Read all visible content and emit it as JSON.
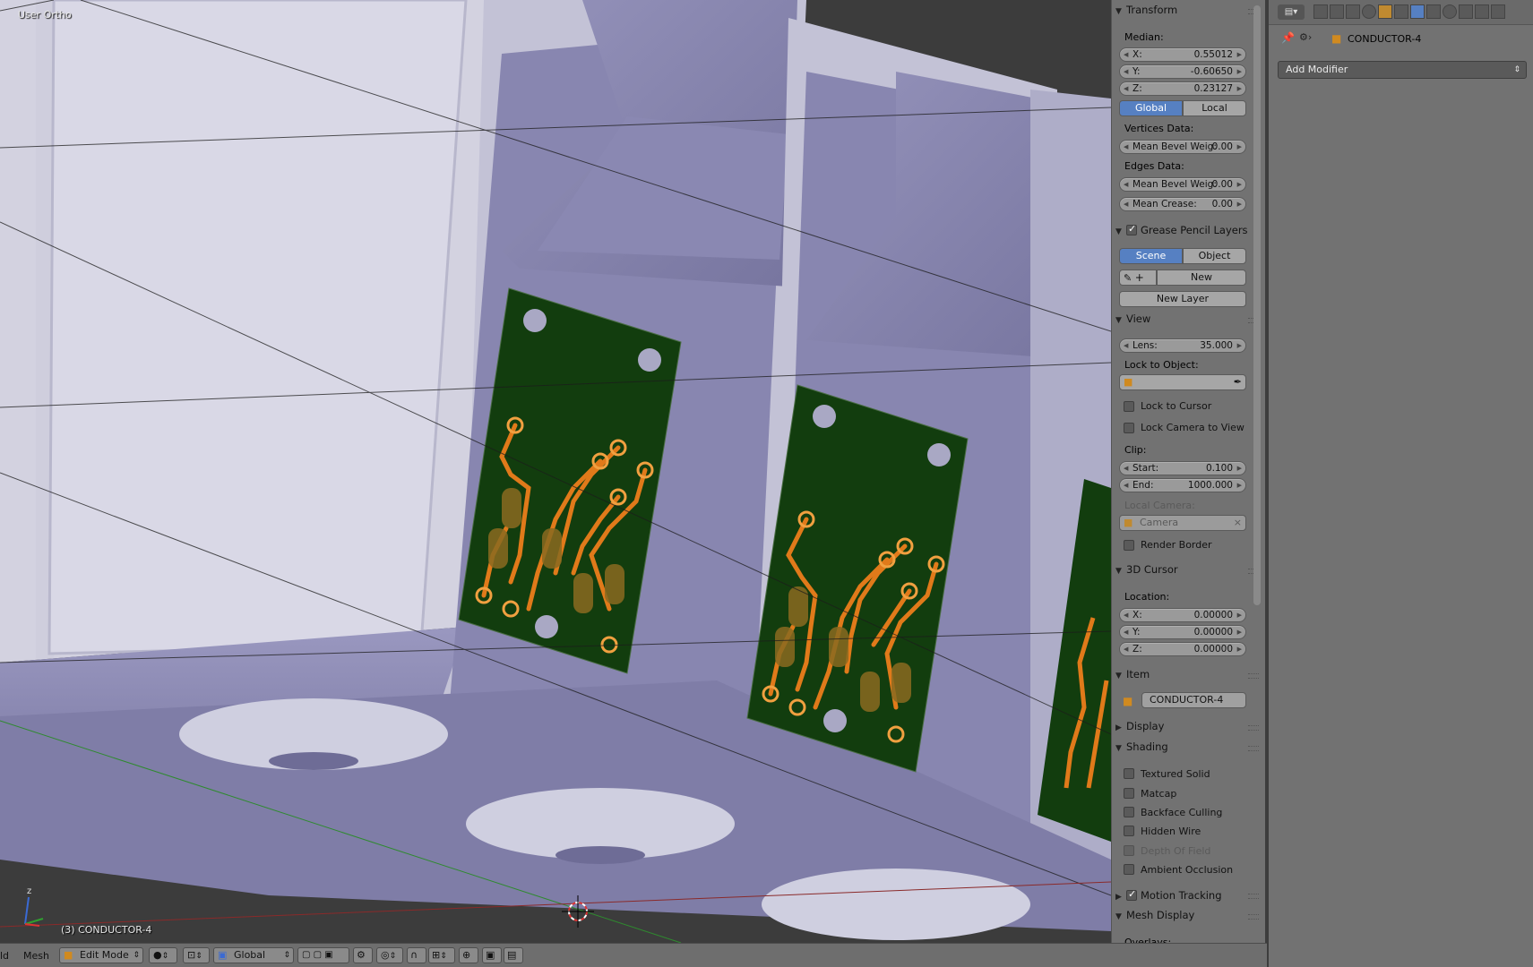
{
  "viewport": {
    "view_label": "User Ortho",
    "object_label": "(3) CONDUCTOR-4"
  },
  "npanel": {
    "transform": {
      "header": "Transform",
      "median_label": "Median:",
      "x_label": "X:",
      "x_value": "0.55012",
      "y_label": "Y:",
      "y_value": "-0.60650",
      "z_label": "Z:",
      "z_value": "0.23127",
      "global_label": "Global",
      "local_label": "Local",
      "vertices_data_label": "Vertices Data:",
      "vert_bevel_label": "Mean Bevel Weig:",
      "vert_bevel_value": "0.00",
      "edges_data_label": "Edges Data:",
      "edge_bevel_label": "Mean Bevel Weig:",
      "edge_bevel_value": "0.00",
      "crease_label": "Mean Crease:",
      "crease_value": "0.00"
    },
    "grease_pencil": {
      "header": "Grease Pencil Layers",
      "enabled": true,
      "scene_label": "Scene",
      "object_label": "Object",
      "new_label": "New",
      "new_layer_label": "New Layer"
    },
    "view": {
      "header": "View",
      "lens_label": "Lens:",
      "lens_value": "35.000",
      "lock_object_label": "Lock to Object:",
      "lock_cursor_label": "Lock to Cursor",
      "lock_camera_label": "Lock Camera to View",
      "clip_label": "Clip:",
      "start_label": "Start:",
      "start_value": "0.100",
      "end_label": "End:",
      "end_value": "1000.000",
      "local_camera_label": "Local Camera:",
      "camera_value": "Camera",
      "render_border_label": "Render Border"
    },
    "cursor": {
      "header": "3D Cursor",
      "location_label": "Location:",
      "x_label": "X:",
      "x_value": "0.00000",
      "y_label": "Y:",
      "y_value": "0.00000",
      "z_label": "Z:",
      "z_value": "0.00000"
    },
    "item": {
      "header": "Item",
      "name": "CONDUCTOR-4"
    },
    "display": {
      "header": "Display"
    },
    "shading": {
      "header": "Shading",
      "textured_solid": "Textured Solid",
      "matcap": "Matcap",
      "backface_culling": "Backface Culling",
      "hidden_wire": "Hidden Wire",
      "depth_of_field": "Depth Of Field",
      "ambient_occlusion": "Ambient Occlusion"
    },
    "motion_tracking": {
      "header": "Motion Tracking",
      "enabled": true
    },
    "mesh_display": {
      "header": "Mesh Display",
      "overlays_label": "Overlays:"
    }
  },
  "properties": {
    "object_name": "CONDUCTOR-4",
    "add_modifier_label": "Add Modifier"
  },
  "bottom_bar": {
    "view_menu": "ld",
    "mesh_menu": "Mesh",
    "mode_value": "Edit Mode",
    "orientation_value": "Global"
  },
  "colors": {
    "panel_bg": "#727272",
    "button_active": "#5680c2",
    "pcb_green": "#123d0e",
    "trace_orange": "#e07a1a",
    "body_lilac": "#a8a6c8"
  }
}
